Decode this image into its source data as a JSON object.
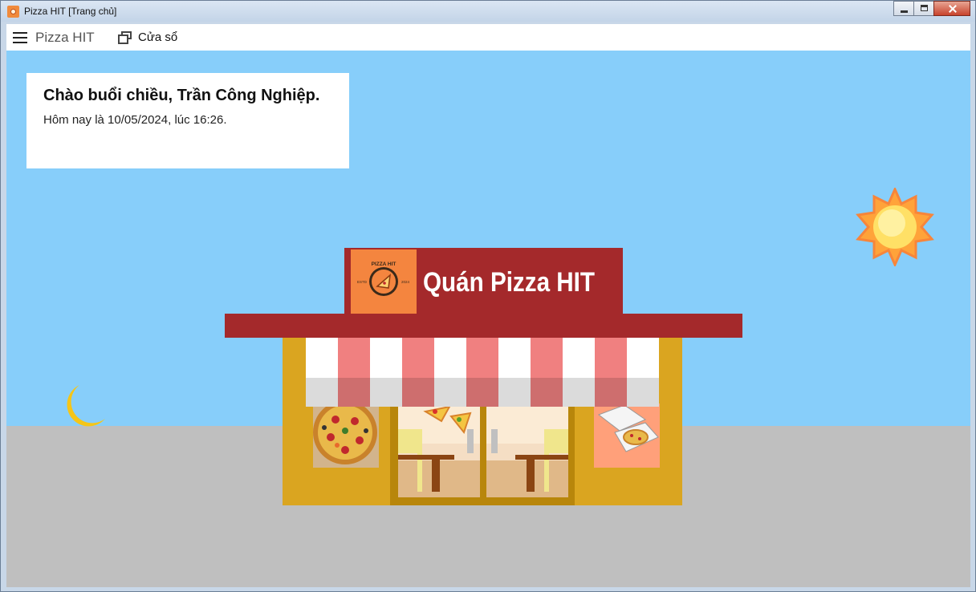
{
  "window": {
    "title": "Pizza HIT [Trang chủ]"
  },
  "menu": {
    "app_label": "Pizza HIT",
    "window_label": "Cửa sổ"
  },
  "greeting": {
    "title": "Chào buổi chiều, Trần Công Nghiệp.",
    "subtitle": "Hôm nay là 10/05/2024, lúc 16:26."
  },
  "shop": {
    "sign": "Quán Pizza HIT",
    "logo_top": "PIZZA HIT",
    "logo_left": "ESTD",
    "logo_right": "2024"
  },
  "colors": {
    "sky": "#87CEFA",
    "ground": "#BFBFBF",
    "roof": "#A4292B",
    "walls": "#DAA520",
    "stripe": "#F08080",
    "logo_bg": "#F4853F",
    "sun": "#FFD43B",
    "moon": "#F5C518"
  },
  "icons": {
    "menu": "hamburger-icon",
    "window": "window-icon",
    "sun": "sun-icon",
    "moon": "moon-icon"
  }
}
